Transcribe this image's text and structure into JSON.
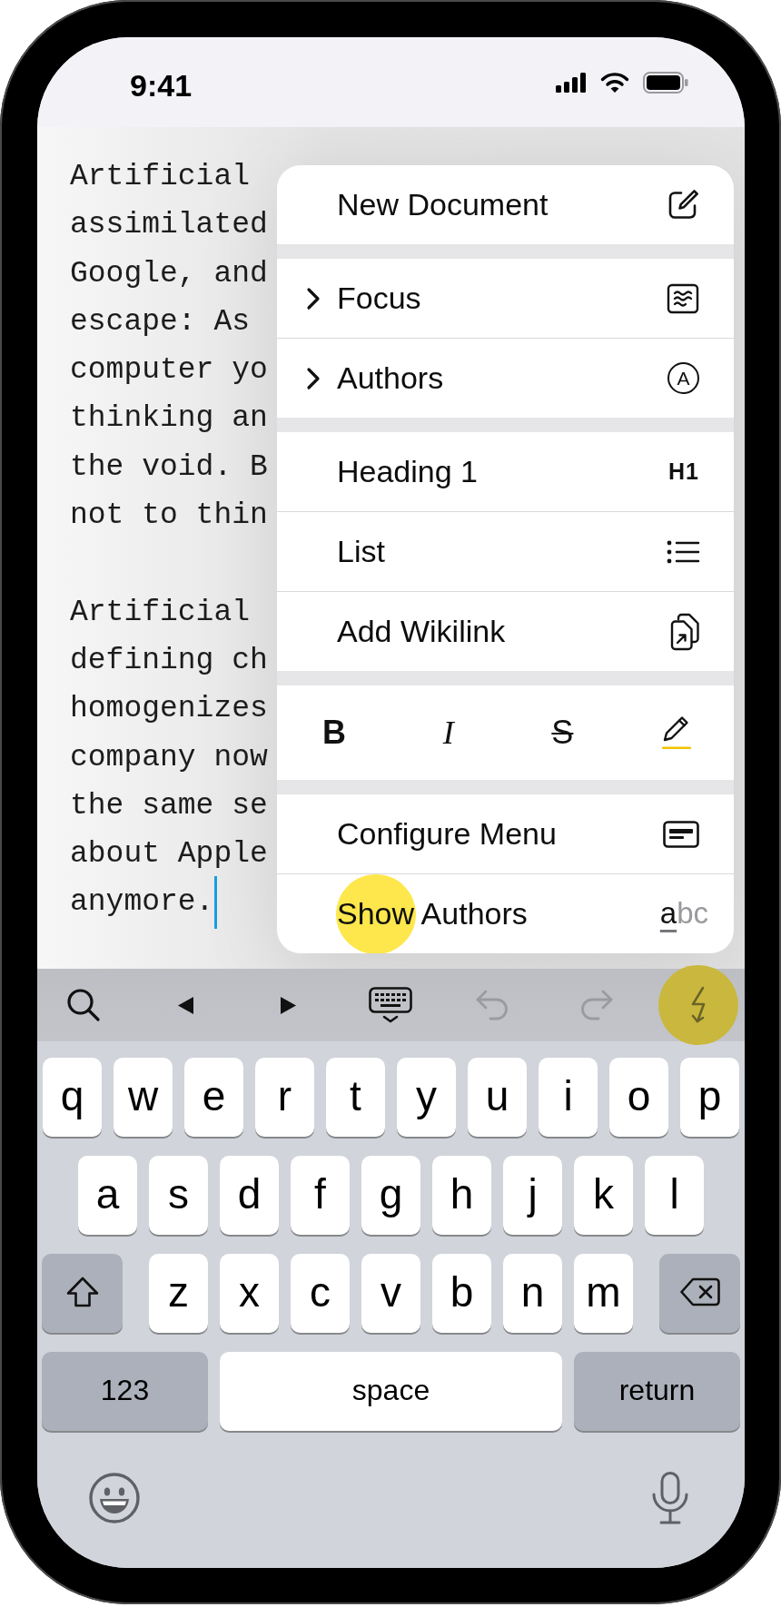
{
  "status_bar": {
    "time": "9:41"
  },
  "document": {
    "paragraphs": [
      {
        "lines": [
          "Artificial",
          "assimilated",
          "Google, and",
          "escape: As",
          "computer yo",
          "thinking an",
          "the void. B",
          "not to thin"
        ]
      },
      {
        "lines": [
          "Artificial",
          "defining ch",
          "homogenizes",
          "company now",
          "the same se",
          "about Apple",
          "anymore."
        ]
      }
    ]
  },
  "menu": {
    "sections": [
      {
        "kind": "list",
        "items": [
          {
            "label": "New Document",
            "submenu": false,
            "touched": false,
            "accessory": {
              "kind": "icon"
            }
          }
        ]
      },
      {
        "kind": "list",
        "items": [
          {
            "label": "Focus",
            "submenu": true,
            "touched": false,
            "accessory": {
              "kind": "icon"
            }
          },
          {
            "label": "Authors",
            "submenu": true,
            "touched": false,
            "accessory": {
              "kind": "circled",
              "text": "A"
            }
          }
        ]
      },
      {
        "kind": "list",
        "items": [
          {
            "label": "Heading 1",
            "submenu": false,
            "touched": false,
            "accessory": {
              "kind": "badge",
              "text": "H1"
            }
          },
          {
            "label": "List",
            "submenu": false,
            "touched": false,
            "accessory": {
              "kind": "icon"
            }
          },
          {
            "label": "Add Wikilink",
            "submenu": false,
            "touched": false,
            "accessory": {
              "kind": "icon"
            }
          }
        ]
      },
      {
        "kind": "format",
        "buttons": [
          {
            "kind": "bold",
            "label": "B"
          },
          {
            "kind": "italic",
            "label": "I"
          },
          {
            "kind": "strike",
            "label": "S"
          },
          {
            "kind": "highlight"
          }
        ]
      },
      {
        "kind": "list",
        "items": [
          {
            "label": "Configure Menu",
            "submenu": false,
            "touched": false,
            "accessory": {
              "kind": "icon"
            }
          },
          {
            "label": "Show Authors",
            "submenu": false,
            "touched": true,
            "accessory": {
              "kind": "spelling",
              "parts": [
                {
                  "text": "a",
                  "underlined": true,
                  "dimmed": false
                },
                {
                  "text": "bc",
                  "underlined": false,
                  "dimmed": true
                }
              ]
            }
          }
        ]
      }
    ]
  },
  "toolbar": {
    "items": [
      {
        "disabled": false,
        "touched": false
      },
      {
        "disabled": false,
        "touched": false
      },
      {
        "disabled": false,
        "touched": false
      },
      {
        "disabled": false,
        "touched": false
      },
      {
        "disabled": true,
        "touched": false
      },
      {
        "disabled": true,
        "touched": false
      },
      {
        "disabled": false,
        "touched": true
      }
    ]
  },
  "keyboard": {
    "rows": [
      {
        "keys": [
          {
            "kind": "letter",
            "label": "q"
          },
          {
            "kind": "letter",
            "label": "w"
          },
          {
            "kind": "letter",
            "label": "e"
          },
          {
            "kind": "letter",
            "label": "r"
          },
          {
            "kind": "letter",
            "label": "t"
          },
          {
            "kind": "letter",
            "label": "y"
          },
          {
            "kind": "letter",
            "label": "u"
          },
          {
            "kind": "letter",
            "label": "i"
          },
          {
            "kind": "letter",
            "label": "o"
          },
          {
            "kind": "letter",
            "label": "p"
          }
        ]
      },
      {
        "keys": [
          {
            "kind": "letter",
            "label": "a"
          },
          {
            "kind": "letter",
            "label": "s"
          },
          {
            "kind": "letter",
            "label": "d"
          },
          {
            "kind": "letter",
            "label": "f"
          },
          {
            "kind": "letter",
            "label": "g"
          },
          {
            "kind": "letter",
            "label": "h"
          },
          {
            "kind": "letter",
            "label": "j"
          },
          {
            "kind": "letter",
            "label": "k"
          },
          {
            "kind": "letter",
            "label": "l"
          }
        ]
      },
      {
        "keys": [
          {
            "kind": "shift"
          },
          {
            "kind": "letter",
            "label": "z"
          },
          {
            "kind": "letter",
            "label": "x"
          },
          {
            "kind": "letter",
            "label": "c"
          },
          {
            "kind": "letter",
            "label": "v"
          },
          {
            "kind": "letter",
            "label": "b"
          },
          {
            "kind": "letter",
            "label": "n"
          },
          {
            "kind": "letter",
            "label": "m"
          },
          {
            "kind": "delete"
          }
        ]
      },
      {
        "keys": [
          {
            "kind": "numbers",
            "label": "123"
          },
          {
            "kind": "space",
            "label": "space"
          },
          {
            "kind": "return",
            "label": "return"
          }
        ]
      }
    ]
  }
}
